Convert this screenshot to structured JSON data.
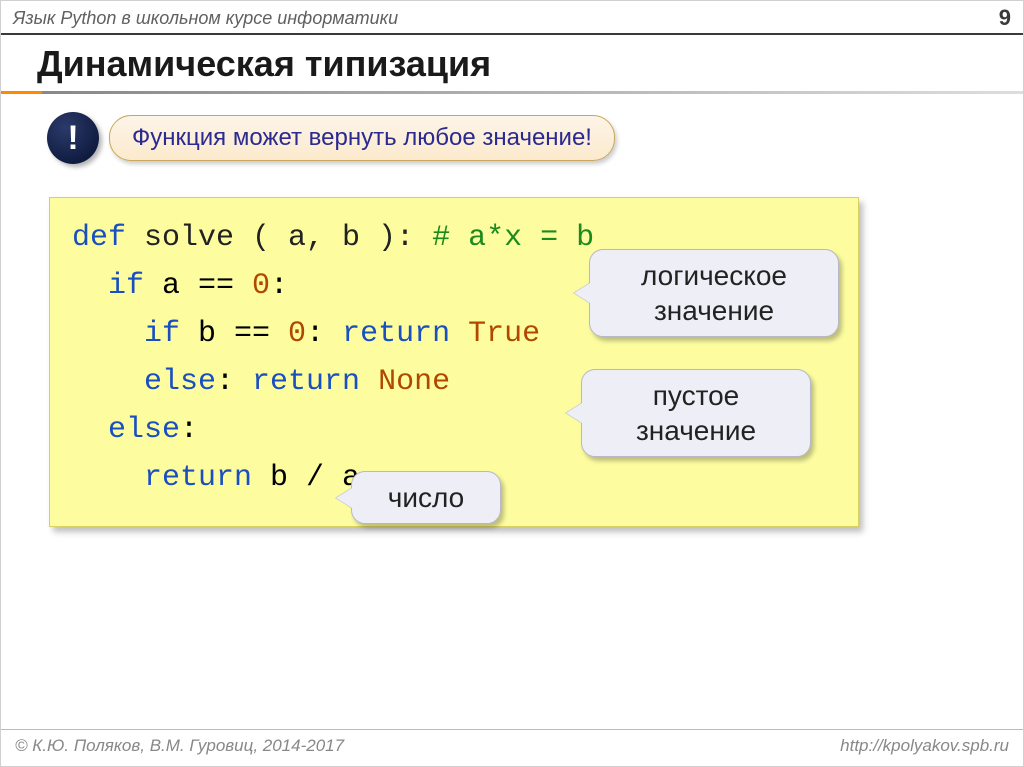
{
  "header": {
    "course": "Язык Python в школьном курсе информатики",
    "page": "9"
  },
  "title": "Динамическая типизация",
  "callout": {
    "bang": "!",
    "text": "Функция может вернуть любое значение!"
  },
  "code": {
    "l1": {
      "def": "def",
      "name": " solve ( a, b ):",
      "comment": "  # a*x = b"
    },
    "l2": {
      "if": "if",
      "cond": " a == ",
      "zero": "0",
      "colon": ":"
    },
    "l3": {
      "if": "if",
      "cond": " b == ",
      "zero": "0",
      "colon": ": ",
      "ret": "return ",
      "val": "True"
    },
    "l4": {
      "else": "else",
      "colon": ": ",
      "ret": "return ",
      "val": "None"
    },
    "l5": {
      "else": "else",
      "colon": ":"
    },
    "l6": {
      "ret": "return",
      "expr": " b / a"
    }
  },
  "balloons": {
    "b1": "логическое значение",
    "b2": "пустое значение",
    "b3": "число"
  },
  "footer": {
    "left": "© К.Ю. Поляков, В.М. Гуровиц, 2014-2017",
    "right": "http://kpolyakov.spb.ru"
  }
}
